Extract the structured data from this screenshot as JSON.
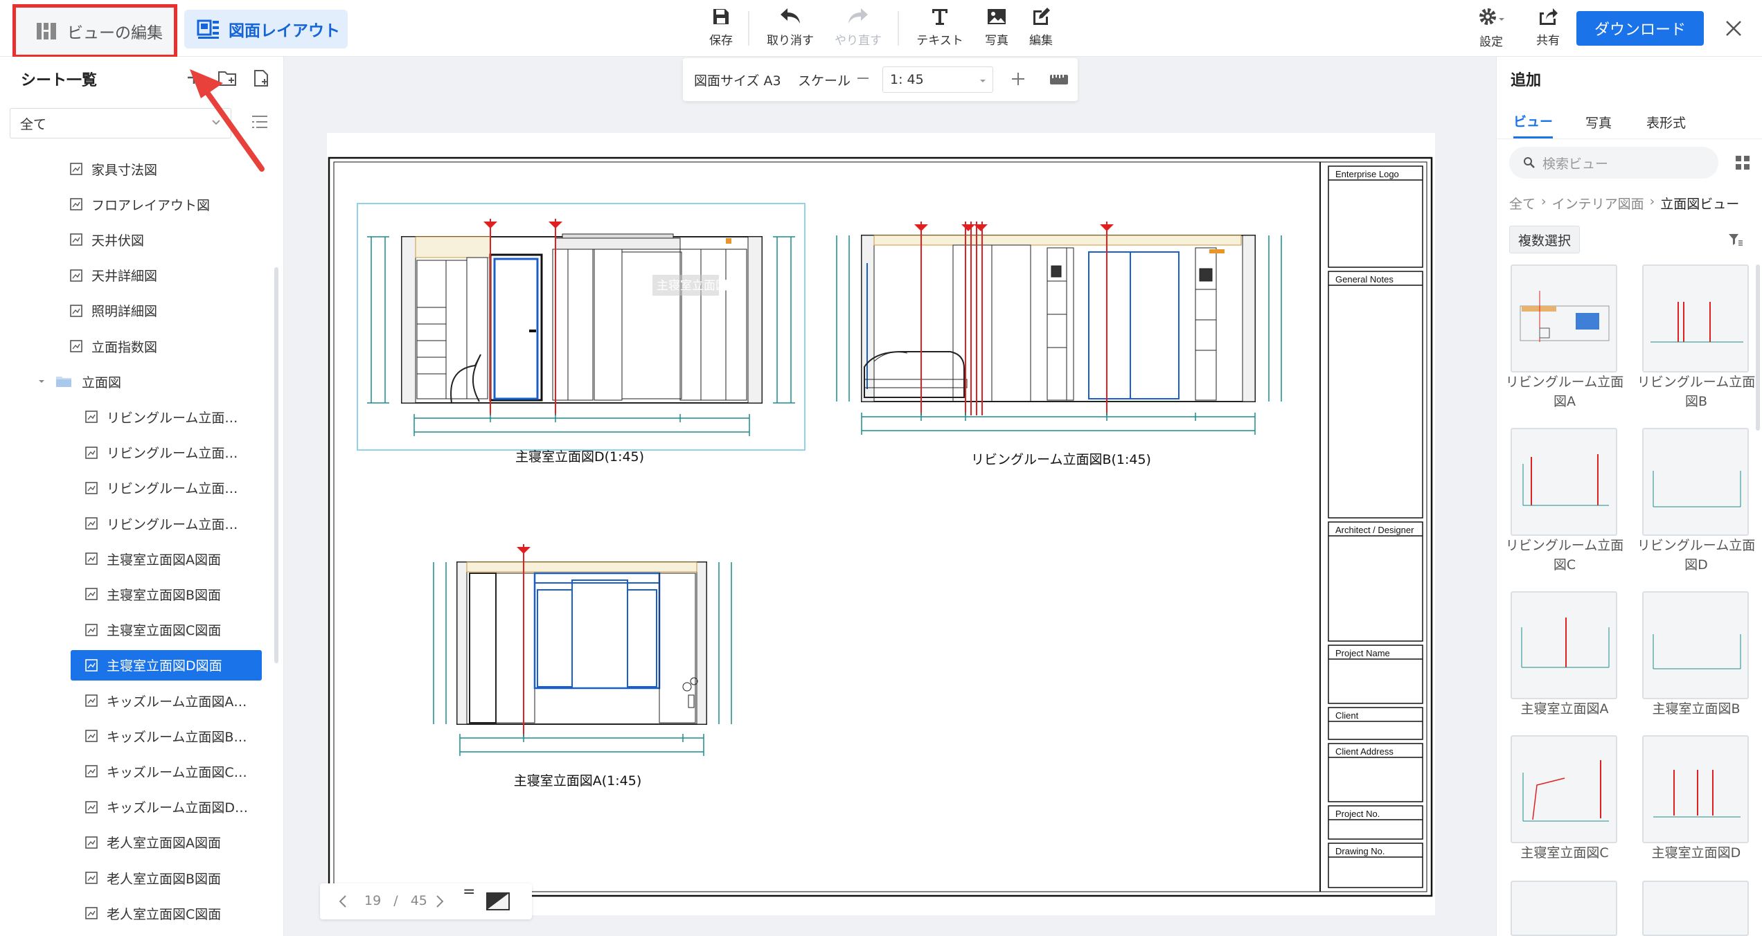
{
  "header": {
    "edit_view_label": "ビューの編集",
    "layout_label": "図面レイアウト",
    "toolbar": {
      "save": "保存",
      "undo": "取り消す",
      "redo": "やり直す",
      "text": "テキスト",
      "photo": "写真",
      "edit": "編集"
    },
    "settings": "設定",
    "share": "共有",
    "download": "ダウンロード"
  },
  "size_bar": {
    "size_label": "図面サイズ A3",
    "scale_label": "スケール",
    "scale_value": "1: 45"
  },
  "sheet_list": {
    "title": "シート一覧",
    "filter_value": "全て",
    "items": [
      "家具寸法図",
      "フロアレイアウト図",
      "天井伏図",
      "天井詳細図",
      "照明詳細図",
      "立面指数図"
    ],
    "folder": "立面図",
    "folder_items": [
      "リビングルーム立面…",
      "リビングルーム立面…",
      "リビングルーム立面…",
      "リビングルーム立面…",
      "主寝室立面図A図面",
      "主寝室立面図B図面",
      "主寝室立面図C図面",
      "主寝室立面図D図面",
      "キッズルーム立面図A…",
      "キッズルーム立面図B…",
      "キッズルーム立面図C…",
      "キッズルーム立面図D…",
      "老人室立面図A図面",
      "老人室立面図B図面",
      "老人室立面図C図面"
    ],
    "selected_index": 7
  },
  "sheet": {
    "view1_caption": "主寝室立面図D(1:45)",
    "view1_watermark": "主寝室立面図D",
    "view2_caption": "リビングルーム立面図B(1:45)",
    "view3_caption": "主寝室立面図A(1:45)",
    "title_block": {
      "logo": "Enterprise Logo",
      "notes": "General Notes",
      "architect": "Architect / Designer",
      "project_name": "Project Name",
      "client": "Client",
      "client_address": "Client Address",
      "project_no": "Project No.",
      "drawing_no": "Drawing No."
    }
  },
  "pager": {
    "current": "19",
    "separator": "/",
    "total": "45",
    "eq": "="
  },
  "add_panel": {
    "title": "追加",
    "tabs": [
      "ビュー",
      "写真",
      "表形式"
    ],
    "search_placeholder": "検索ビュー",
    "breadcrumb": [
      "全て",
      "インテリア図面",
      "立面図ビュー"
    ],
    "multi_select": "複数選択",
    "thumbs": [
      "リビングルーム立面図A",
      "リビングルーム立面図B",
      "リビングルーム立面図C",
      "リビングルーム立面図D",
      "主寝室立面図A",
      "主寝室立面図B",
      "主寝室立面図C",
      "主寝室立面図D"
    ]
  },
  "colors": {
    "accent": "#1a73e8",
    "highlight": "#e8312f",
    "dimension": "#1b8c8c"
  }
}
